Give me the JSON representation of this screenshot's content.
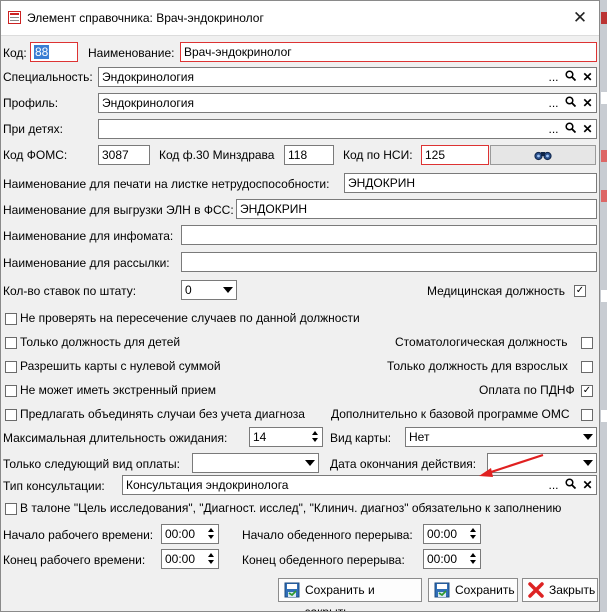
{
  "window": {
    "title": "Элемент справочника: Врач-эндокринолог"
  },
  "fields": {
    "code": {
      "label": "Код:",
      "value": "88"
    },
    "name": {
      "label": "Наименование:",
      "value": "Врач-эндокринолог"
    },
    "specialty": {
      "label": "Специальность:",
      "value": "Эндокринология"
    },
    "profile": {
      "label": "Профиль:",
      "value": "Эндокринология"
    },
    "children": {
      "label": "При детях:",
      "value": ""
    },
    "foms": {
      "label": "Код ФОМС:",
      "value": "3087"
    },
    "f30": {
      "label": "Код ф.30 Минздрава",
      "value": "118"
    },
    "nsi": {
      "label": "Код по НСИ:",
      "value": "125"
    },
    "print_name": {
      "label": "Наименование для печати на листке нетрудоспособности:",
      "value": "ЭНДОКРИН"
    },
    "eln_name": {
      "label": "Наименование для выгрузки ЭЛН в ФСС:",
      "value": "ЭНДОКРИН"
    },
    "infomat_name": {
      "label": "Наименование для инфомата:",
      "value": ""
    },
    "mailing_name": {
      "label": "Наименование для рассылки:",
      "value": ""
    },
    "rates": {
      "label": "Кол-во ставок по штату:",
      "value": "0"
    },
    "max_wait": {
      "label": "Максимальная длительность ожидания:",
      "value": "14"
    },
    "card_type": {
      "label": "Вид карты:",
      "value": "Нет"
    },
    "next_payment": {
      "label": "Только следующий вид оплаты:",
      "value": ""
    },
    "end_date": {
      "label": "Дата окончания действия:",
      "value": ""
    },
    "consult_type": {
      "label": "Тип консультации:",
      "value": "Консультация эндокринолога"
    },
    "work_start": {
      "label": "Начало рабочего времени:",
      "value": "00:00"
    },
    "work_end": {
      "label": "Конец рабочего времени:",
      "value": "00:00"
    },
    "lunch_start": {
      "label": "Начало обеденного перерыва:",
      "value": "00:00"
    },
    "lunch_end": {
      "label": "Конец обеденного перерыва:",
      "value": "00:00"
    }
  },
  "checkboxes": {
    "medical_position": {
      "label": "Медицинская должность",
      "checked": true
    },
    "no_overlap_check": {
      "label": "Не проверять на пересечение случаев по данной должности",
      "checked": false
    },
    "children_only": {
      "label": "Только должность для детей",
      "checked": false
    },
    "dental_position": {
      "label": "Стоматологическая должность",
      "checked": false
    },
    "zero_sum_cards": {
      "label": "Разрешить карты с нулевой суммой",
      "checked": false
    },
    "adults_only": {
      "label": "Только должность для взрослых",
      "checked": false
    },
    "no_emergency": {
      "label": "Не может иметь экстренный прием",
      "checked": false
    },
    "pdnf_payment": {
      "label": "Оплата по ПДНФ",
      "checked": true
    },
    "merge_no_diag": {
      "label": "Предлагать объединять случаи без учета диагноза",
      "checked": false
    },
    "extra_oms": {
      "label": "Дополнительно к базовой программе ОМС",
      "checked": false
    },
    "talon_required": {
      "label": "В талоне \"Цель исследования\", \"Диагност. исслед\", \"Клинич. диагноз\" обязательно к заполнению",
      "checked": false
    }
  },
  "lookup_icons": {
    "dots": "...",
    "search": "search-icon",
    "clear": "✕"
  },
  "buttons": {
    "save_close": "Сохранить и закрыть",
    "save": "Сохранить",
    "close": "Закрыть"
  },
  "colors": {
    "accent_red": "#d33333",
    "selection": "#3b7ed3",
    "annotation_arrow": "#e02020"
  }
}
